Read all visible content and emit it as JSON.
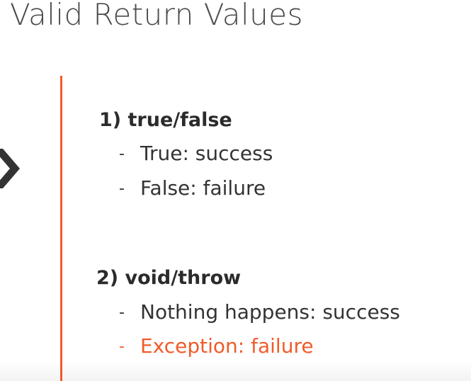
{
  "slide": {
    "title": "Valid Return Values",
    "accent_color": "#f15b2a",
    "sections": [
      {
        "heading": "1) true/false",
        "items": [
          {
            "bullet": "-",
            "text": "True: success"
          },
          {
            "bullet": "-",
            "text": "False: failure"
          }
        ]
      },
      {
        "heading": "2) void/throw",
        "items": [
          {
            "bullet": "-",
            "text": "Nothing happens: success"
          },
          {
            "bullet": "-",
            "text": "Exception: failure",
            "highlighted": true
          }
        ]
      }
    ],
    "icons": [
      "chevron-right-icon"
    ]
  }
}
